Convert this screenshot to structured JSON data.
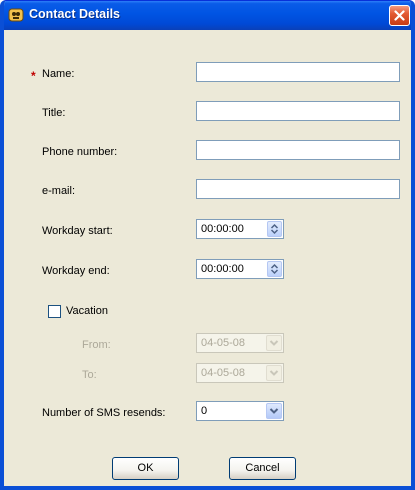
{
  "window": {
    "title": "Contact Details"
  },
  "form": {
    "name_label": "Name:",
    "name_value": "",
    "title_label": "Title:",
    "title_value": "",
    "phone_label": "Phone number:",
    "phone_value": "",
    "email_label": "e-mail:",
    "email_value": "",
    "workday_start_label": "Workday start:",
    "workday_start_value": "00:00:00",
    "workday_end_label": "Workday end:",
    "workday_end_value": "00:00:00",
    "vacation_label": "Vacation",
    "vacation_checked": false,
    "from_label": "From:",
    "from_value": "04-05-08",
    "to_label": "To:",
    "to_value": "04-05-08",
    "sms_label": "Number of SMS resends:",
    "sms_value": "0"
  },
  "buttons": {
    "ok_label": "OK",
    "cancel_label": "Cancel"
  },
  "colors": {
    "title_bar": "#0054e3",
    "dialog_bg": "#ece9d8",
    "required_marker": "#c00000"
  }
}
